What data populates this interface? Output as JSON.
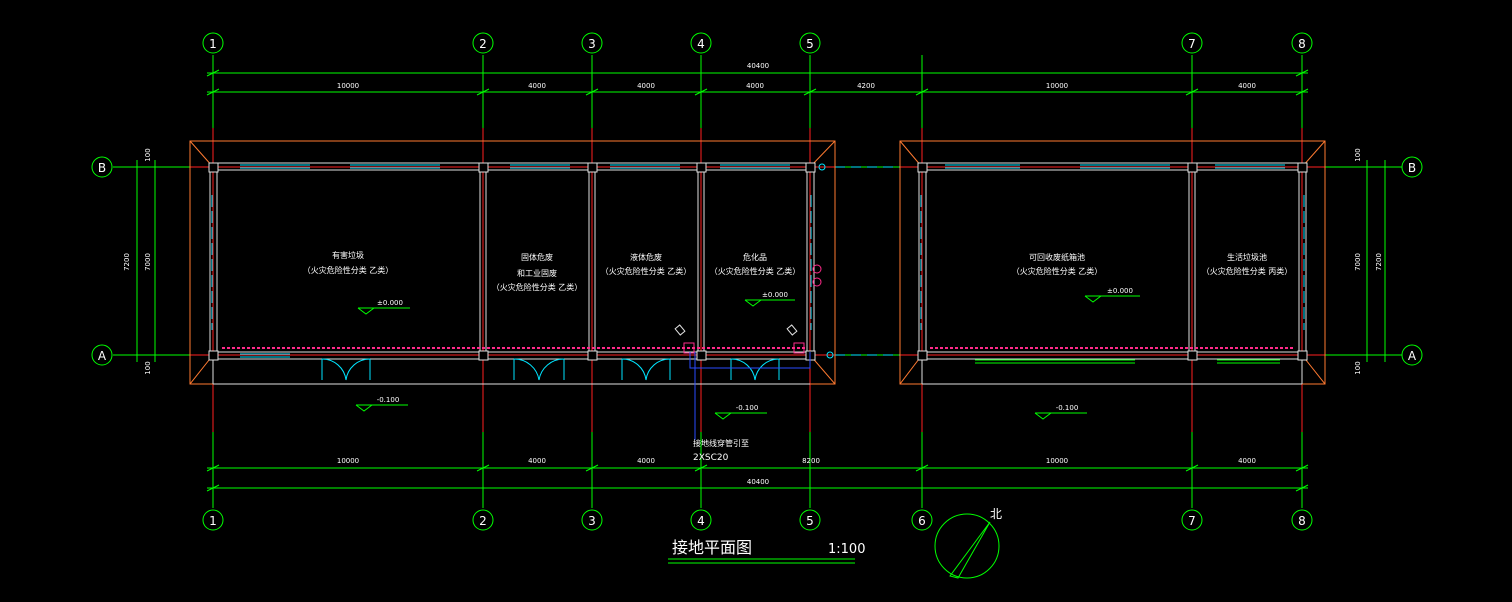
{
  "axes": {
    "top": [
      "1",
      "2",
      "3",
      "4",
      "5",
      "7",
      "8"
    ],
    "bottom": [
      "1",
      "2",
      "3",
      "4",
      "5",
      "6",
      "7",
      "8"
    ],
    "rows": [
      "B",
      "A"
    ]
  },
  "dimensions": {
    "top_total": "40400",
    "top_segments": [
      "10000",
      "4000",
      "4000",
      "4000",
      "4200",
      "10000",
      "4000"
    ],
    "bottom_total": "40400",
    "bottom_segments": [
      "10000",
      "4000",
      "4000",
      "8200",
      "10000",
      "4000"
    ],
    "left_outer": "7200",
    "left_inner": "7000",
    "left_edge_top": "100",
    "left_edge_bottom": "100",
    "right_outer": "7200",
    "right_inner": "7000",
    "right_edge_top": "100",
    "right_edge_bottom": "100"
  },
  "rooms": [
    {
      "name": "有害垃圾",
      "note": "（火灾危险性分类 乙类）",
      "elevation": "±0.000"
    },
    {
      "name": "固体危废",
      "name2": "和工业固废",
      "note": "（火灾危险性分类 乙类）"
    },
    {
      "name": "液体危废",
      "note": "（火灾危险性分类 乙类）"
    },
    {
      "name": "危化品",
      "note": "（火灾危险性分类 乙类）",
      "elevation": "±0.000"
    },
    {
      "name": "可回收废纸箱池",
      "note": "（火灾危险性分类 乙类）",
      "elevation": "±0.000"
    },
    {
      "name": "生活垃圾池",
      "note": "（火灾危险性分类 丙类）"
    }
  ],
  "outside_elevations": [
    "-0.100",
    "-0.100",
    "-0.100"
  ],
  "annotations": {
    "ground_cable": "接地线穿管引至",
    "conduit": "2XSC20"
  },
  "title": "接地平面图",
  "scale": "1:100",
  "north": "北",
  "colors": {
    "axis_line": "#ff2020",
    "dim": "#00ff00",
    "wall": "#e0e0e0",
    "eave": "#ff7a30",
    "window": "#00e5ff",
    "door": "#00e5ff",
    "earthing": "#ff2a8a",
    "text": "#ffffff",
    "bubble": "#00ff00",
    "cable": "#2a4bff"
  }
}
